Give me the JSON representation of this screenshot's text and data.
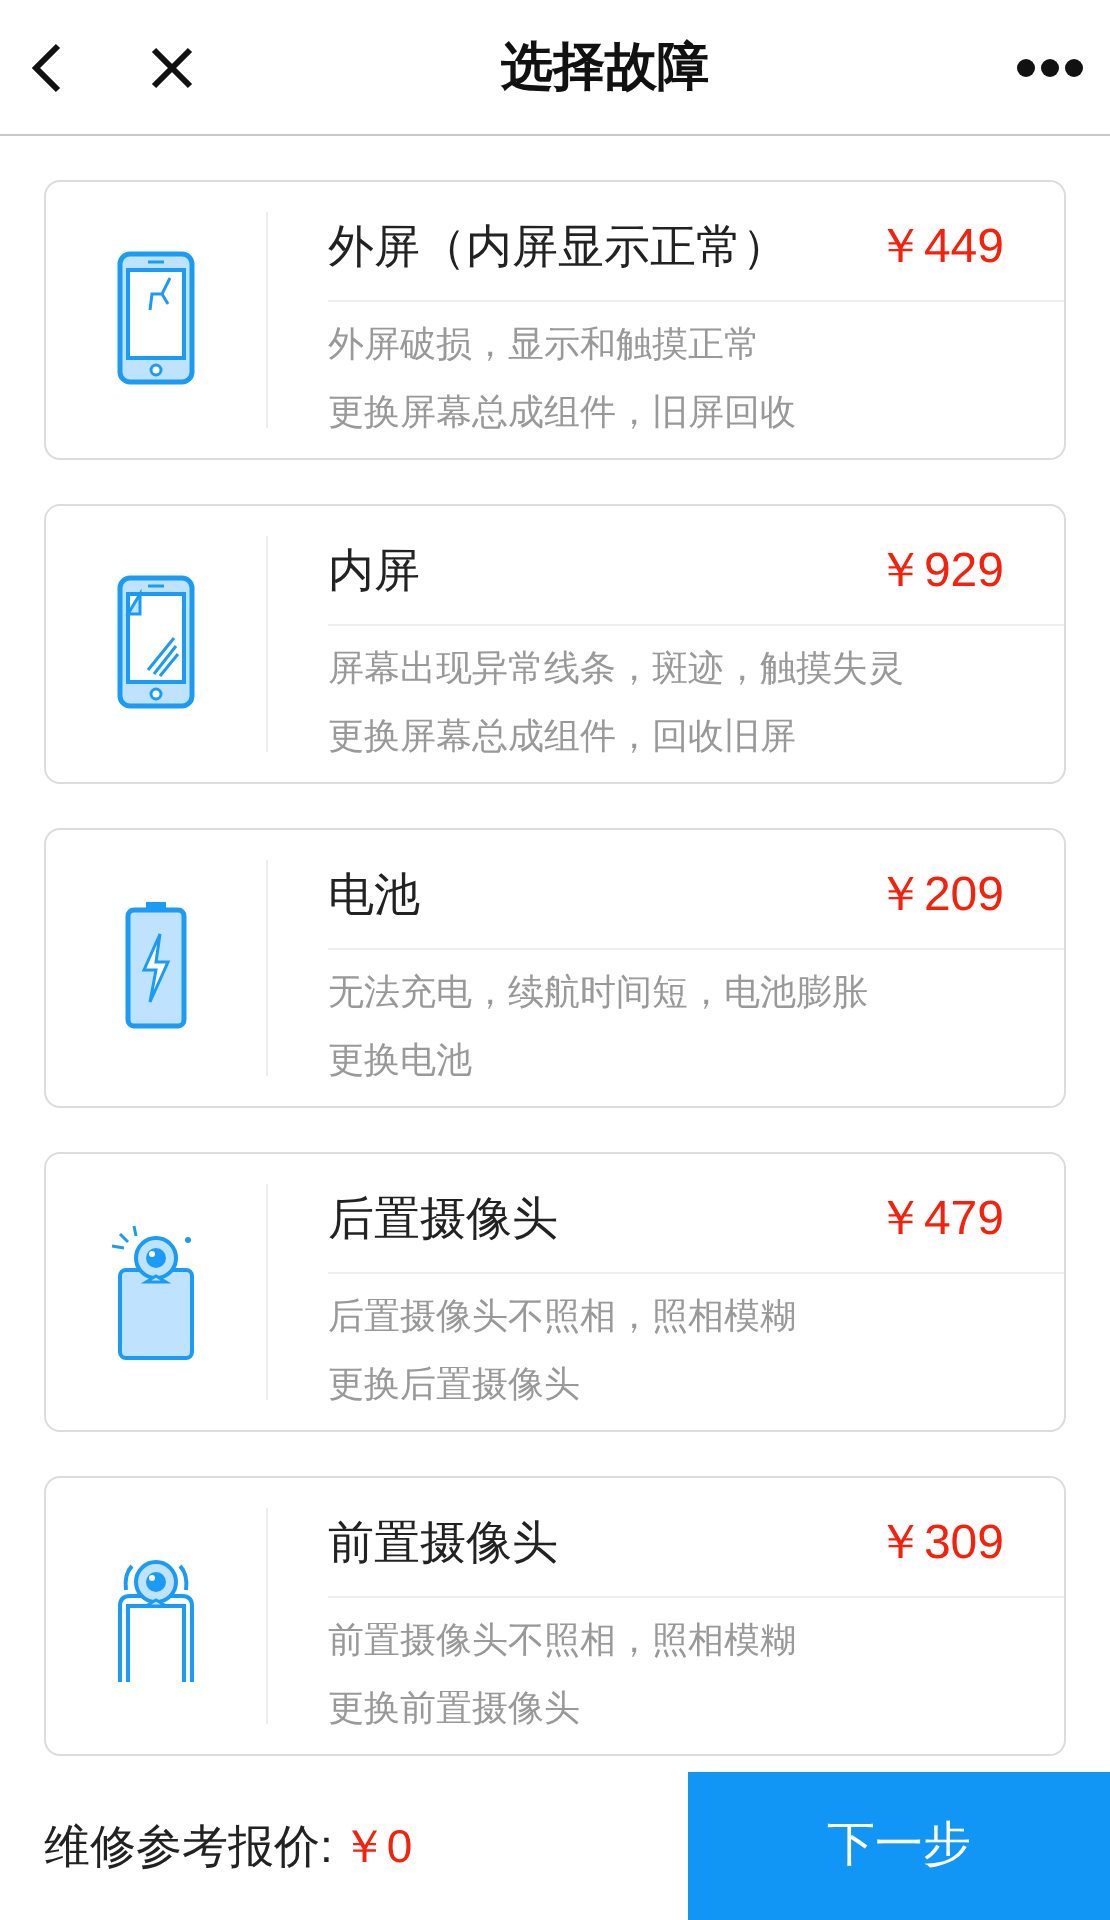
{
  "header": {
    "title": "选择故障"
  },
  "faults": [
    {
      "kind": "cracked-screen",
      "name": "外屏（内屏显示正常）",
      "price": "￥449",
      "symptom": "外屏破损，显示和触摸正常",
      "remedy": "更换屏幕总成组件，旧屏回收"
    },
    {
      "kind": "inner-screen",
      "name": "内屏",
      "price": "￥929",
      "symptom": "屏幕出现异常线条，斑迹，触摸失灵",
      "remedy": "更换屏幕总成组件，回收旧屏"
    },
    {
      "kind": "battery",
      "name": "电池",
      "price": "￥209",
      "symptom": "无法充电，续航时间短，电池膨胀",
      "remedy": "更换电池"
    },
    {
      "kind": "rear-camera",
      "name": "后置摄像头",
      "price": "￥479",
      "symptom": "后置摄像头不照相，照相模糊",
      "remedy": "更换后置摄像头"
    },
    {
      "kind": "front-camera",
      "name": "前置摄像头",
      "price": "￥309",
      "symptom": "前置摄像头不照相，照相模糊",
      "remedy": "更换前置摄像头"
    }
  ],
  "footer": {
    "label": "维修参考报价:",
    "total": "￥0",
    "button": "下一步"
  }
}
